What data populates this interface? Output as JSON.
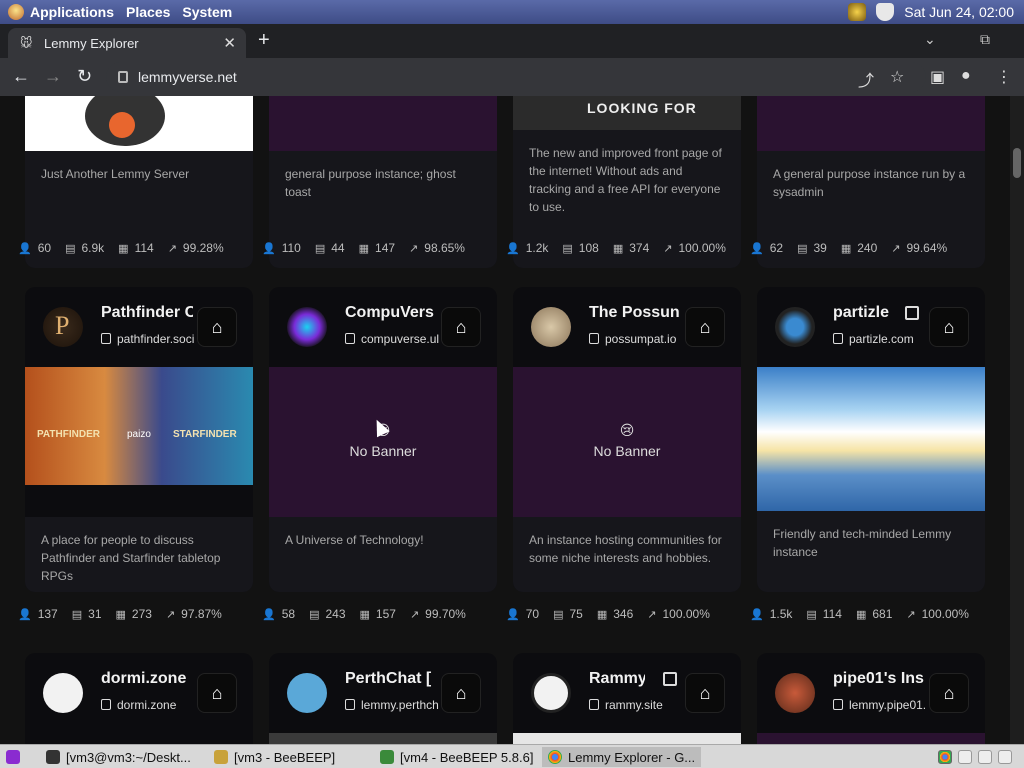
{
  "topbar": {
    "menus": [
      "Applications",
      "Places",
      "System"
    ],
    "clock": "Sat Jun 24, 02:00"
  },
  "browser": {
    "tab_title": "Lemmy Explorer",
    "url": "lemmyverse.net"
  },
  "cards_top": [
    {
      "desc": "Just Another Lemmy Server",
      "stats": [
        "60",
        "6.9k",
        "114",
        "99.28%"
      ]
    },
    {
      "desc": "general purpose instance; ghost toast",
      "stats": [
        "110",
        "44",
        "147",
        "98.65%"
      ]
    },
    {
      "desc": "The new and improved front page of the internet! Without ads and tracking and a free API for everyone to use.",
      "stats": [
        "1.2k",
        "108",
        "374",
        "100.00%"
      ],
      "banner_text": "LOOKING FOR"
    },
    {
      "desc": "A general purpose instance run by a sysadmin",
      "stats": [
        "62",
        "39",
        "240",
        "99.64%"
      ]
    }
  ],
  "cards_mid": [
    {
      "title": "Pathfinder C",
      "domain": "pathfinder.soci",
      "desc": "A place for people to discuss Pathfinder and Starfinder tabletop RPGs",
      "stats": [
        "137",
        "31",
        "273",
        "97.87%"
      ],
      "banner_labels": [
        "PATHFINDER",
        "paizo",
        "STARFINDER"
      ]
    },
    {
      "title": "CompuVers",
      "domain": "compuverse.ul",
      "desc": "A Universe of Technology!",
      "stats": [
        "58",
        "243",
        "157",
        "99.70%"
      ],
      "no_banner": "No Banner"
    },
    {
      "title": "The Possun",
      "domain": "possumpat.io",
      "desc": "An instance hosting communities for some niche interests and hobbies.",
      "stats": [
        "70",
        "75",
        "346",
        "100.00%"
      ],
      "no_banner": "No Banner"
    },
    {
      "title": "partizle",
      "domain": "partizle.com",
      "desc": "Friendly and tech-minded Lemmy instance",
      "stats": [
        "1.5k",
        "114",
        "681",
        "100.00%"
      ]
    }
  ],
  "cards_bottom": [
    {
      "title": "dormi.zone",
      "domain": "dormi.zone"
    },
    {
      "title": "PerthChat  [",
      "domain": "lemmy.perthch"
    },
    {
      "title": "Rammy",
      "domain": "rammy.site"
    },
    {
      "title": "pipe01's Ins",
      "domain": "lemmy.pipe01."
    }
  ],
  "taskbar": {
    "items": [
      "[vm3@vm3:~/Deskt...",
      "[vm3 - BeeBEEP]",
      "[vm4 - BeeBEEP 5.8.6]",
      "Lemmy Explorer - G..."
    ]
  },
  "colors": {
    "accent": "#8ab4f8",
    "card_bg": "#0c0c0f",
    "banner_bg": "#2a1230"
  }
}
